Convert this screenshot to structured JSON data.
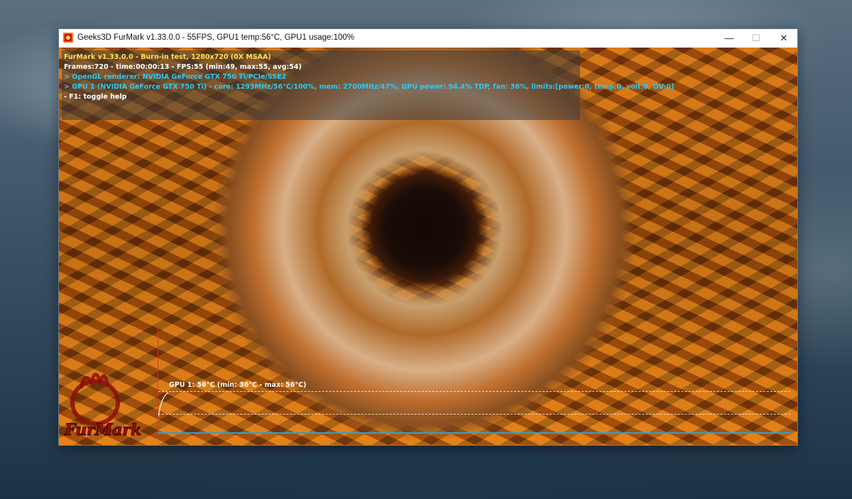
{
  "window": {
    "title": "Geeks3D FurMark v1.33.0.0 - 55FPS, GPU1 temp:56°C, GPU1 usage:100%",
    "minimize": "—",
    "maximize": "☐",
    "close": "✕"
  },
  "hud": {
    "line1": "FurMark v1.33.0.0 - Burn-in test, 1280x720 (0X MSAA)",
    "line2": "Frames:720 - time:00:00:13 - FPS:55 (min:49, max:55, avg:54)",
    "line3": "> OpenGL renderer: NVIDIA GeForce GTX 750 Ti/PCIe/SSE2",
    "line4": "> GPU 1 (NVIDIA GeForce GTX 750 Ti) - core: 1293MHz/56°C/100%, mem: 2700MHz/47%, GPU power: 94.4% TDP, fan: 36%, limits:[power:0, temp:0, volt:0, OV:0]",
    "line5": "- F1: toggle help",
    "colors": {
      "title": "#ffe24a",
      "stats": "#ffffff",
      "info": "#32c8f0",
      "help": "#ffffff"
    }
  },
  "graph": {
    "label": "GPU 1: 56°C (min: 36°C - max: 56°C)"
  },
  "logo": {
    "text": "FurMark"
  }
}
